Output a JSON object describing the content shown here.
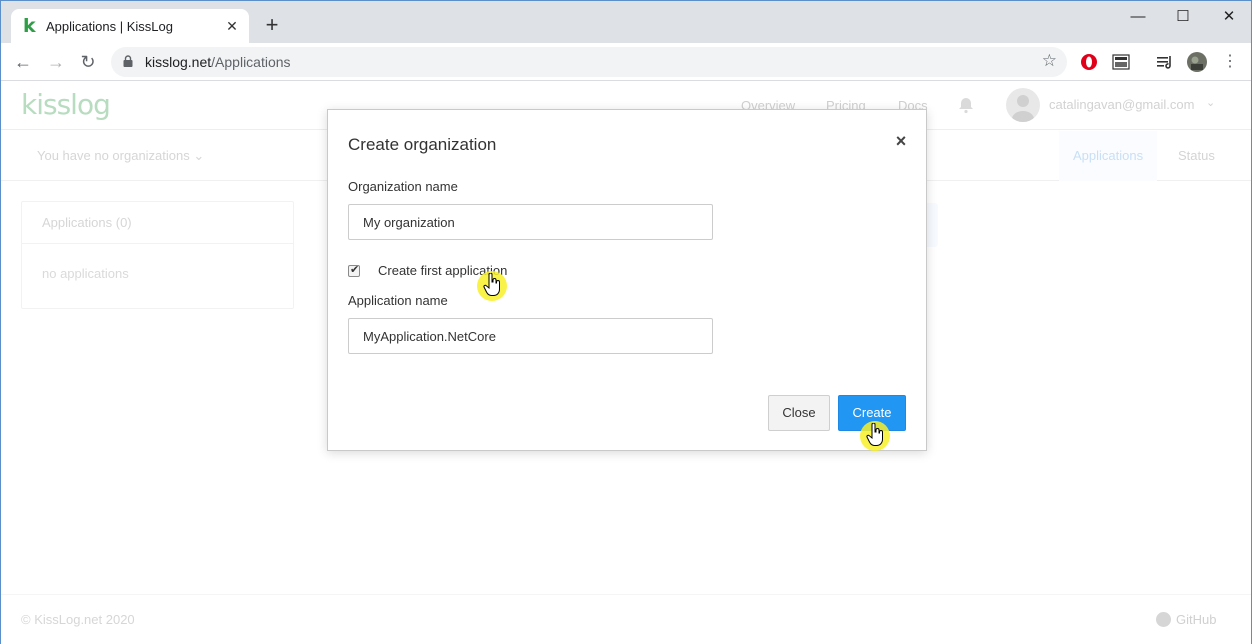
{
  "browser": {
    "tab_title": "Applications | KissLog",
    "favicon_letter": "k",
    "url_host": "kisslog.net",
    "url_path": "/Applications",
    "new_tab_symbol": "+",
    "window_controls": {
      "minimize": "—",
      "maximize": "☐",
      "close": "✕"
    }
  },
  "site": {
    "logo": "kisslog",
    "nav": [
      "Overview",
      "Pricing",
      "Docs"
    ],
    "user_email": "catalingavan@gmail.com",
    "org_selector": "You have no organizations",
    "subtabs": {
      "applications": "Applications",
      "status": "Status"
    },
    "apps_panel": {
      "header": "Applications",
      "count": "(0)",
      "empty": "no applications"
    },
    "footer": {
      "copyright": "© KissLog.net 2020",
      "github": "GitHub"
    }
  },
  "modal": {
    "title": "Create organization",
    "close_symbol": "×",
    "org_name_label": "Organization name",
    "org_name_value": "My organization",
    "create_first_app_label": "Create first application",
    "create_first_app_checked": true,
    "app_name_label": "Application name",
    "app_name_value": "MyApplication.NetCore",
    "close_button": "Close",
    "create_button": "Create"
  },
  "colors": {
    "accent": "#2196f3",
    "logo": "#b7dcc0",
    "cursor_highlight": "#f8f028"
  }
}
